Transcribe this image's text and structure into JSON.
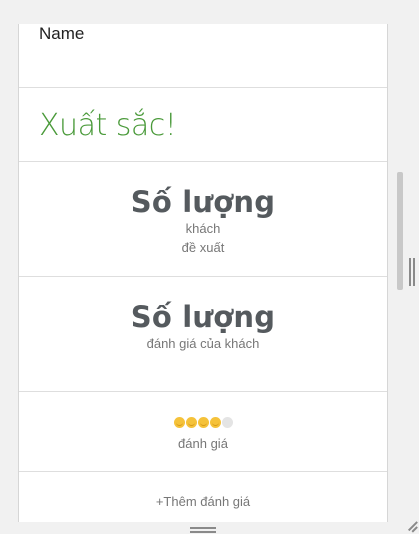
{
  "card": {
    "name_label": "Name",
    "rating_title": "Xuất sắc!",
    "stats": [
      {
        "value": "Số lượng",
        "label_line1": "khách",
        "label_line2": "đề xuất"
      },
      {
        "value": "Số lượng",
        "label_line1": "đánh giá của khách"
      }
    ],
    "rating": {
      "score": 4,
      "max": 5,
      "label": "đánh giá"
    },
    "add_review_label": "+Thêm đánh giá"
  },
  "colors": {
    "accent_green": "#4a9a3a",
    "star_on": "#f5c23a",
    "star_off": "#e4e4e4",
    "stat_text": "#555a5e"
  }
}
